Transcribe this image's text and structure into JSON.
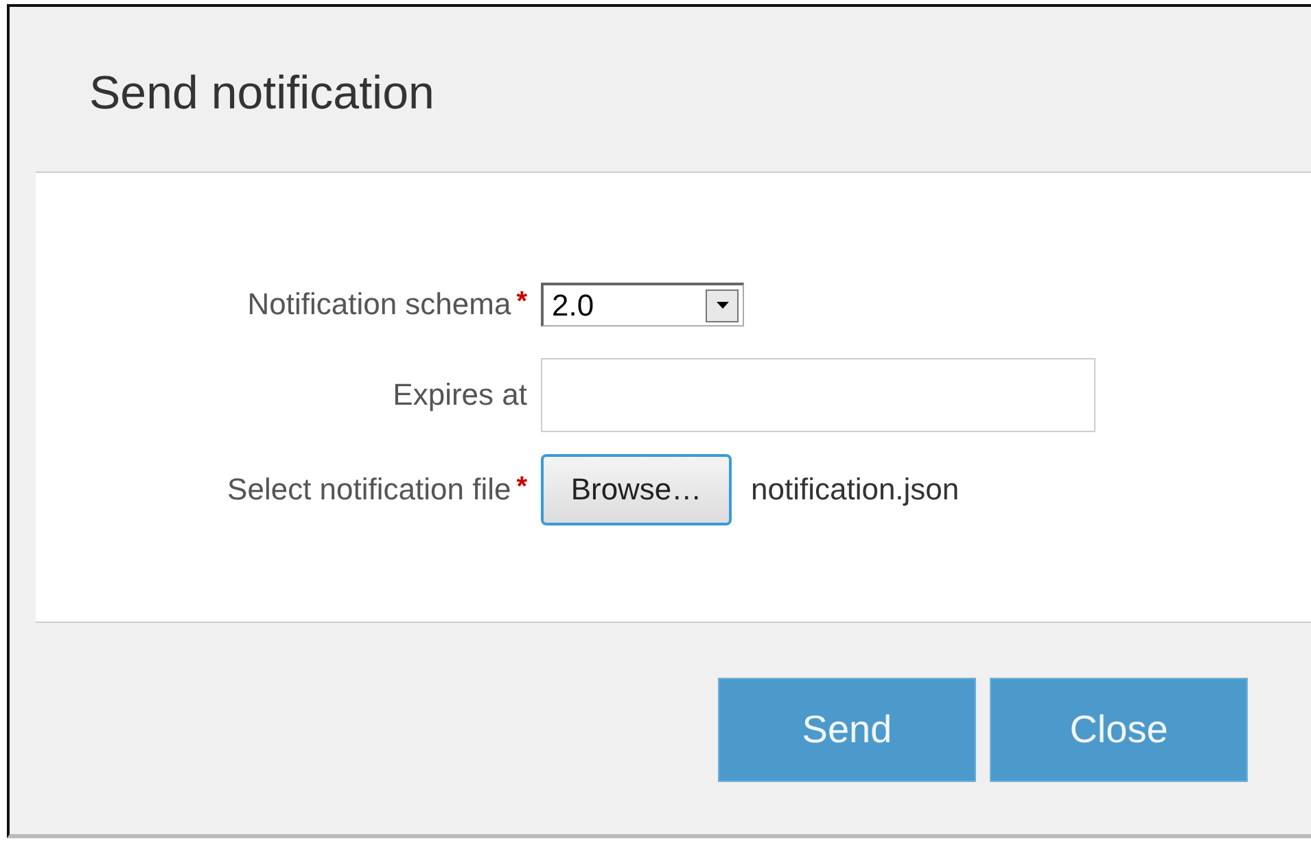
{
  "dialog": {
    "title": "Send notification"
  },
  "fields": [
    {
      "kind": "select",
      "label": "Notification schema",
      "required_mark": "*",
      "value": "2.0"
    },
    {
      "kind": "text",
      "label": "Expires at"
    },
    {
      "kind": "file",
      "label": "Select notification file",
      "required_mark": "*",
      "button": "Browse…",
      "file_name": "notification.json"
    }
  ],
  "buttons": [
    "Send",
    "Close"
  ]
}
